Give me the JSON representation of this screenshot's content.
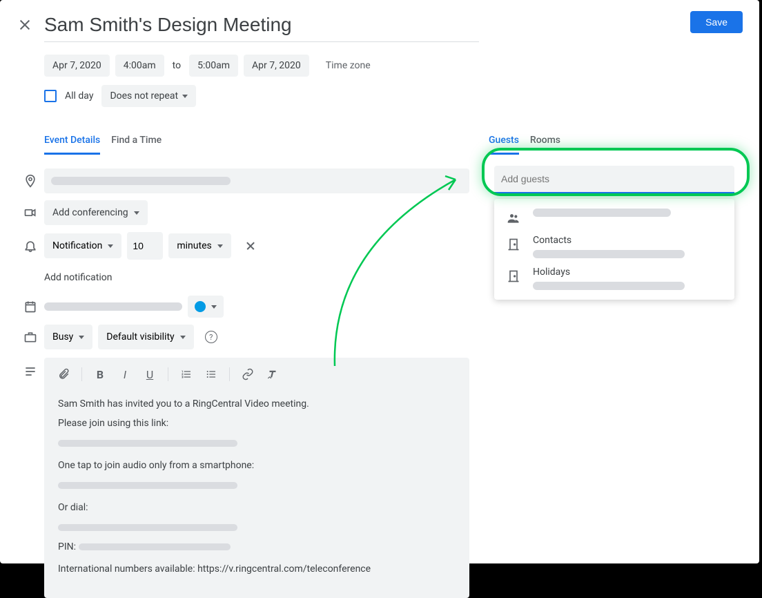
{
  "title": "Sam Smith's Design Meeting",
  "save_label": "Save",
  "date": {
    "start_date": "Apr 7, 2020",
    "start_time": "4:00am",
    "to": "to",
    "end_time": "5:00am",
    "end_date": "Apr 7, 2020",
    "timezone": "Time zone"
  },
  "allday": {
    "label": "All day",
    "repeat": "Does not repeat"
  },
  "tabs": {
    "details": "Event Details",
    "find": "Find a Time"
  },
  "conf": {
    "label": "Add conferencing"
  },
  "notif": {
    "type": "Notification",
    "value": "10",
    "unit": "minutes",
    "add": "Add notification"
  },
  "busy": {
    "label": "Busy"
  },
  "visibility": {
    "label": "Default visibility"
  },
  "desc": {
    "l1": "Sam Smith has invited you to a RingCentral Video meeting.",
    "l2": "Please join using this link:",
    "l3": "One tap to join audio only from a smartphone:",
    "l4": "Or dial:",
    "l5": "PIN:",
    "l6": "International numbers available: https://v.ringcentral.com/teleconference"
  },
  "right_tabs": {
    "guests": "Guests",
    "rooms": "Rooms"
  },
  "guests": {
    "placeholder": "Add guests"
  },
  "suggestions": {
    "contacts": "Contacts",
    "holidays": "Holidays"
  }
}
